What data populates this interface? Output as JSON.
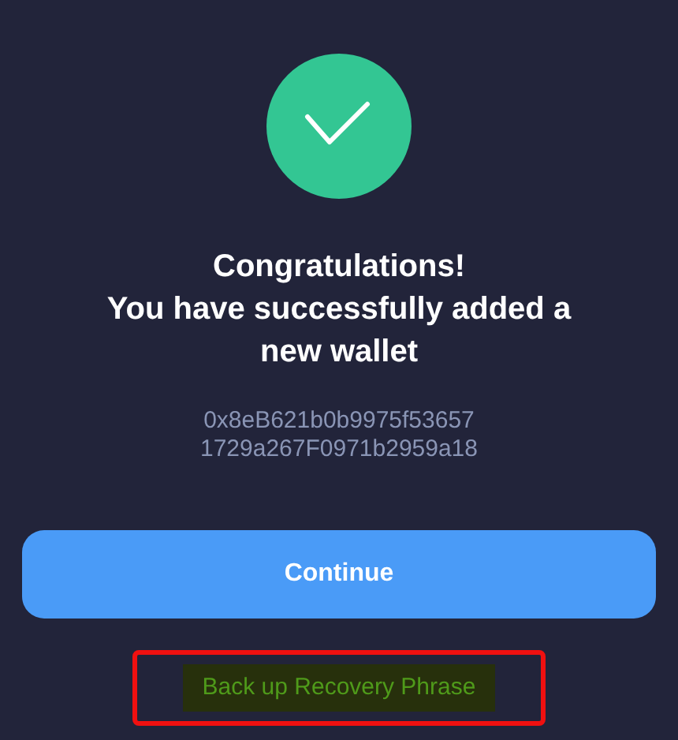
{
  "title_lines": [
    "Congratulations!",
    "You have successfully added a new wallet"
  ],
  "address_lines": [
    "0x8eB621b0b9975f53657",
    "1729a267F0971b2959a18"
  ],
  "primary_button": {
    "label": "Continue"
  },
  "secondary_link": {
    "label": "Back up Recovery Phrase",
    "highlighted": true
  }
}
